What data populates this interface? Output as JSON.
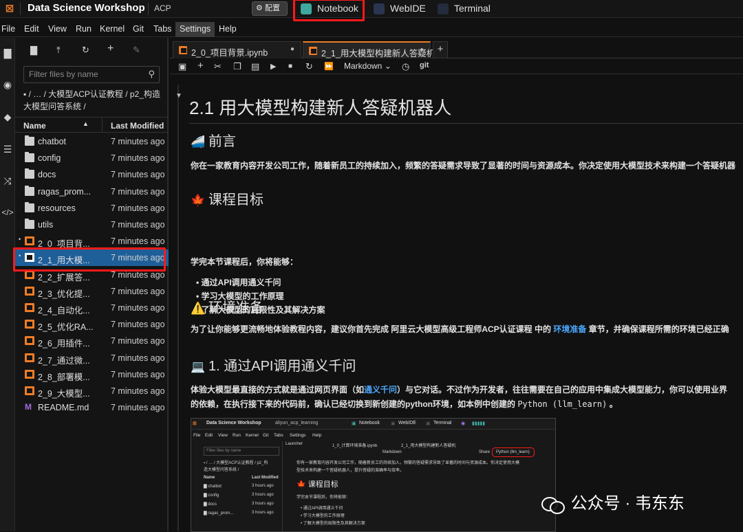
{
  "topbar": {
    "app_title": "Data Science Workshop",
    "acp": "ACP",
    "config_label": "配置",
    "tabs": [
      {
        "label": "Notebook",
        "color": "#3ea99f"
      },
      {
        "label": "WebIDE",
        "color": "#3b4a6b"
      },
      {
        "label": "Terminal",
        "color": "#2f3a52"
      }
    ]
  },
  "menu": [
    "File",
    "Edit",
    "View",
    "Run",
    "Kernel",
    "Git",
    "Tabs",
    "Settings",
    "Help"
  ],
  "filebrowser": {
    "filter_placeholder": "Filter files by name",
    "breadcrumb": "▪ / … / 大模型ACP认证教程 / p2_构造大模型问答系统 /",
    "col_name": "Name",
    "col_modified": "Last Modified",
    "files": [
      {
        "name": "chatbot",
        "modified": "7 minutes ago",
        "type": "folder"
      },
      {
        "name": "config",
        "modified": "7 minutes ago",
        "type": "folder"
      },
      {
        "name": "docs",
        "modified": "7 minutes ago",
        "type": "folder"
      },
      {
        "name": "ragas_prom...",
        "modified": "7 minutes ago",
        "type": "folder"
      },
      {
        "name": "resources",
        "modified": "7 minutes ago",
        "type": "folder"
      },
      {
        "name": "utils",
        "modified": "7 minutes ago",
        "type": "folder"
      },
      {
        "name": "2_0_项目背...",
        "modified": "7 minutes ago",
        "type": "notebook",
        "running": true
      },
      {
        "name": "2_1_用大模...",
        "modified": "7 minutes ago",
        "type": "notebook",
        "running": true,
        "selected": true
      },
      {
        "name": "2_2_扩展答...",
        "modified": "7 minutes ago",
        "type": "notebook"
      },
      {
        "name": "2_3_优化提...",
        "modified": "7 minutes ago",
        "type": "notebook"
      },
      {
        "name": "2_4_自动化...",
        "modified": "7 minutes ago",
        "type": "notebook"
      },
      {
        "name": "2_5_优化RA...",
        "modified": "7 minutes ago",
        "type": "notebook"
      },
      {
        "name": "2_6_用插件...",
        "modified": "7 minutes ago",
        "type": "notebook"
      },
      {
        "name": "2_7_通过微...",
        "modified": "7 minutes ago",
        "type": "notebook"
      },
      {
        "name": "2_8_部署模...",
        "modified": "7 minutes ago",
        "type": "notebook"
      },
      {
        "name": "2_9_大模型...",
        "modified": "7 minutes ago",
        "type": "notebook"
      },
      {
        "name": "README.md",
        "modified": "7 minutes ago",
        "type": "markdown"
      }
    ]
  },
  "editor": {
    "tabs": [
      {
        "label": "2_0_项目背景.ipynb"
      },
      {
        "label": "2_1_用大模型构建新人答疑机",
        "active": true
      }
    ],
    "kernel_label": "Markdown",
    "git_label": "git"
  },
  "notebook": {
    "title": "2.1 用大模型构建新人答疑机器人",
    "sections": {
      "preface": {
        "emoji": "🚄",
        "heading": "前言",
        "text": "你在一家教育内容开发公司工作，随着新员工的持续加入，频繁的答疑需求导致了显著的时间与资源成本。你决定使用大模型技术来构建一个答疑机器"
      },
      "goals": {
        "emoji": "🍁",
        "heading": "课程目标",
        "intro": "学完本节课程后，你将能够：",
        "items": [
          "通过API调用通义千问",
          "学习大模型的工作原理",
          "了解大模型的局限性及其解决方案"
        ]
      },
      "env": {
        "emoji": "⚠️",
        "heading": "环境准备",
        "text_a": "为了让你能够更流畅地体验教程内容，建议你首先完成 ",
        "text_b": "阿里云大模型高级工程师ACP认证课程",
        "text_c": " 中的 ",
        "link": "环境准备",
        "text_d": " 章节，并确保课程所需的环境已经正确"
      },
      "api": {
        "emoji": "💻",
        "heading": "1. 通过API调用通义千问",
        "line1_a": "体验大模型最直接的方式就是通过网页界面（如",
        "line1_link": "通义千问",
        "line1_b": "）与它对话。不过作为开发者，往往需要在自己的应用中集成大模型能力，你可以使用业界",
        "line2_a": "的依赖，在执行接下来的代码前，确认已经切换到新创建的python环境，如本例中创建的 ",
        "line2_code": "Python (llm_learn)",
        "line2_b": " 。"
      }
    }
  },
  "embedded_screenshot": {
    "app_title": "Data Science Workshop",
    "workspace": "aliyun_acp_learning",
    "tabs": [
      "Notebook",
      "WebIDE",
      "Terminal"
    ],
    "menu": [
      "File",
      "Edit",
      "View",
      "Run",
      "Kernel",
      "Git",
      "Tabs",
      "Settings",
      "Help"
    ],
    "filter_placeholder": "Filter files by name",
    "breadcrumb_1": "▪ / … / 大模型ACP认证教程 / p2_构",
    "breadcrumb_2": "造大模型问答系统 /",
    "col_name": "Name",
    "col_modified": "Last Modified",
    "files": [
      {
        "name": "chatbot",
        "modified": "3 hours ago"
      },
      {
        "name": "config",
        "modified": "3 hours ago"
      },
      {
        "name": "docs",
        "modified": "3 hours ago"
      },
      {
        "name": "ragas_prom...",
        "modified": "3 hours ago"
      }
    ],
    "doc_tabs": [
      "Launcher",
      "1_0_计算环境准备.ipynb",
      "2_1_用大模型构建新人答疑机"
    ],
    "kernel_label": "Markdown",
    "kernel_badge": "Python (llm_learn)",
    "share_label": "Share",
    "body_line1": "你有一家教育内容开发公司工作，随着新员工的持续加入，频繁的答疑需求导致了显著的时间与资源成本。你决定使用大模",
    "body_line2": "型技术来构建一个答疑机器人，提升答疑的准确率与效率。",
    "goals_heading": "课程目标",
    "goals_intro": "学完本节课程后，你将能够：",
    "goals_items": [
      "通过API调用通义千问",
      "学习大模型的工作原理",
      "了解大模型的局限性及其解决方案"
    ]
  },
  "watermark": "公众号 · 韦东东",
  "colors": {
    "accent": "#f07c26",
    "highlight": "#ff1a1a",
    "selection": "#1f5f99",
    "link": "#4aa8ff"
  }
}
